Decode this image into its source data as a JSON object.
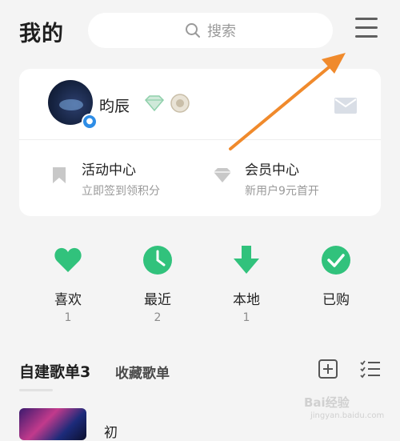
{
  "header": {
    "title": "我的",
    "search_placeholder": "搜索"
  },
  "profile": {
    "username": "昀辰"
  },
  "card_items": [
    {
      "title": "活动中心",
      "subtitle": "立即签到领积分"
    },
    {
      "title": "会员中心",
      "subtitle": "新用户9元首开"
    }
  ],
  "shortcuts": [
    {
      "label": "喜欢",
      "count": "1",
      "icon": "heart-icon"
    },
    {
      "label": "最近",
      "count": "2",
      "icon": "clock-icon"
    },
    {
      "label": "本地",
      "count": "1",
      "icon": "download-icon"
    },
    {
      "label": "已购",
      "count": "",
      "icon": "check-icon"
    }
  ],
  "playlist_tabs": {
    "created": "自建歌单3",
    "collected": "收藏歌单"
  },
  "playlist_rows": [
    {
      "title": "初"
    }
  ],
  "watermark": {
    "text": "Bai经验",
    "url": "jingyan.baidu.com"
  },
  "colors": {
    "accent_green": "#31c27c",
    "annotation_arrow": "#f08a2c"
  }
}
